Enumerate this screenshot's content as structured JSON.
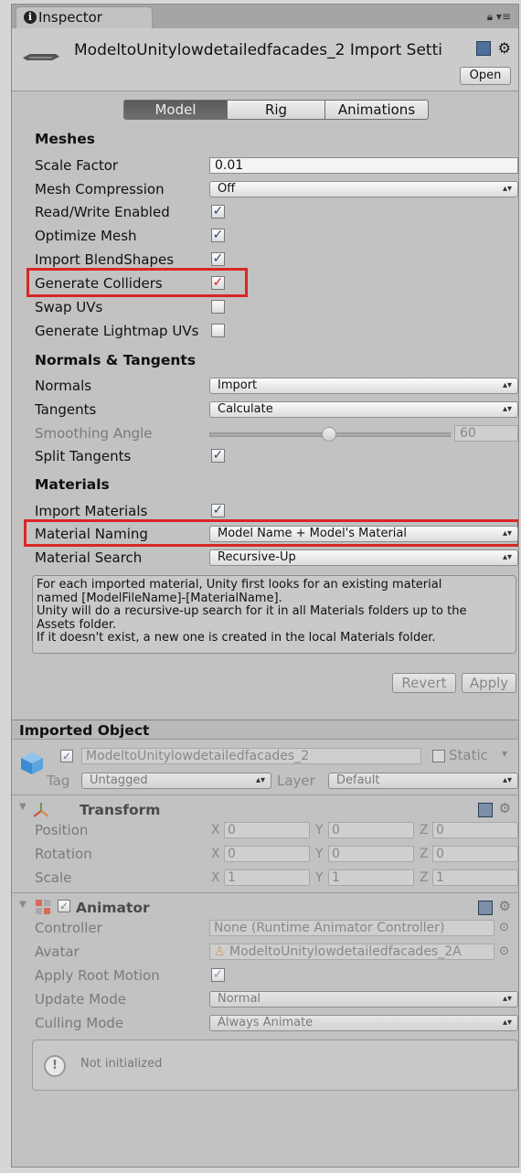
{
  "window": {
    "tab_label": "Inspector",
    "lock_icon": "lock-icon",
    "menu_icon": "menu-icon"
  },
  "header": {
    "title": "ModeltoUnitylowdetailedfacades_2 Import Setti",
    "open_label": "Open",
    "help_icon": "help-book-icon",
    "settings_icon": "gear-icon"
  },
  "tabs": [
    {
      "label": "Model",
      "active": true
    },
    {
      "label": "Rig",
      "active": false
    },
    {
      "label": "Animations",
      "active": false
    }
  ],
  "meshes": {
    "heading": "Meshes",
    "scale_factor": {
      "label": "Scale Factor",
      "value": "0.01"
    },
    "mesh_compression": {
      "label": "Mesh Compression",
      "value": "Off"
    },
    "read_write": {
      "label": "Read/Write Enabled",
      "checked": true
    },
    "optimize_mesh": {
      "label": "Optimize Mesh",
      "checked": true
    },
    "import_blendshapes": {
      "label": "Import BlendShapes",
      "checked": true
    },
    "generate_colliders": {
      "label": "Generate Colliders",
      "checked": true
    },
    "swap_uvs": {
      "label": "Swap UVs",
      "checked": false
    },
    "generate_lightmap_uvs": {
      "label": "Generate Lightmap UVs",
      "checked": false
    }
  },
  "normals": {
    "heading": "Normals & Tangents",
    "normals": {
      "label": "Normals",
      "value": "Import"
    },
    "tangents": {
      "label": "Tangents",
      "value": "Calculate"
    },
    "smoothing_angle": {
      "label": "Smoothing Angle",
      "value": "60",
      "slider_fraction": 0.5
    },
    "split_tangents": {
      "label": "Split Tangents",
      "checked": true
    }
  },
  "materials": {
    "heading": "Materials",
    "import_materials": {
      "label": "Import Materials",
      "checked": true
    },
    "material_naming": {
      "label": "Material Naming",
      "value": "Model Name + Model's Material"
    },
    "material_search": {
      "label": "Material Search",
      "value": "Recursive-Up"
    },
    "help_lines": [
      "For each imported material, Unity first looks for an existing material",
      "named [ModelFileName]-[MaterialName].",
      "Unity will do a recursive-up search for it in all Materials folders up to the",
      "Assets folder.",
      "If it doesn't exist, a new one is created in the local Materials folder."
    ]
  },
  "buttons": {
    "revert": "Revert",
    "apply": "Apply"
  },
  "imported_object": {
    "heading": "Imported Object",
    "name": "ModeltoUnitylowdetailedfacades_2",
    "static_label": "Static",
    "tag_label": "Tag",
    "tag_value": "Untagged",
    "layer_label": "Layer",
    "layer_value": "Default"
  },
  "transform": {
    "heading": "Transform",
    "rows": [
      {
        "label": "Position",
        "x": "0",
        "y": "0",
        "z": "0"
      },
      {
        "label": "Rotation",
        "x": "0",
        "y": "0",
        "z": "0"
      },
      {
        "label": "Scale",
        "x": "1",
        "y": "1",
        "z": "1"
      }
    ],
    "axis_labels": {
      "x": "X",
      "y": "Y",
      "z": "Z"
    }
  },
  "animator": {
    "heading": "Animator",
    "controller": {
      "label": "Controller",
      "value": "None (Runtime Animator Controller)"
    },
    "avatar": {
      "label": "Avatar",
      "value": "ModeltoUnitylowdetailedfacades_2A"
    },
    "apply_root_motion": {
      "label": "Apply Root Motion",
      "checked": true
    },
    "update_mode": {
      "label": "Update Mode",
      "value": "Normal"
    },
    "culling_mode": {
      "label": "Culling Mode",
      "value": "Always Animate"
    },
    "status": "Not initialized"
  },
  "colors": {
    "highlight": "#d92626",
    "panel": "#c2c2c2",
    "active_tab": "#5a5a5a"
  }
}
